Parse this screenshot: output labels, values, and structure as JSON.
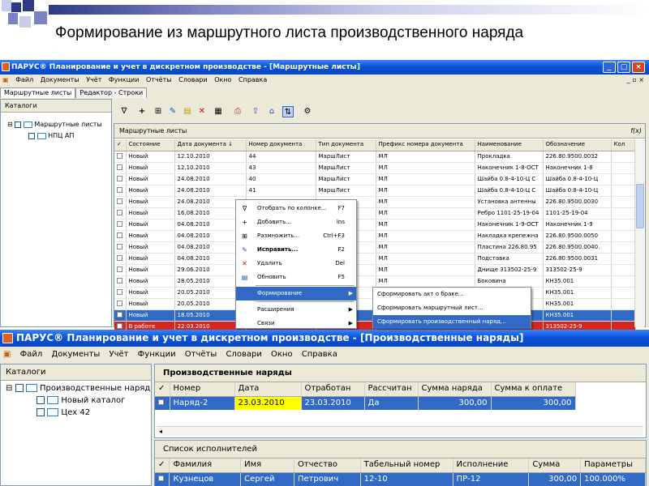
{
  "slide": {
    "title": "Формирование из маршрутного листа производственного наряда",
    "accent_colors": [
      "#2e3a85",
      "#7b82c2",
      "#c9ccea"
    ]
  },
  "window1": {
    "title": "ПАРУС® Планирование и учет в дискретном производстве - [Маршрутные листы]",
    "menu": [
      "Файл",
      "Документы",
      "Учёт",
      "Функции",
      "Отчёты",
      "Словари",
      "Окно",
      "Справка"
    ],
    "tabs": [
      "Маршрутные листы",
      "Редактор - Строки"
    ],
    "catalogs_label": "Каталоги",
    "tree": [
      "Маршрутные листы",
      "НПЦ АП"
    ],
    "grid_title": "Маршрутные листы",
    "fx_label": "f(x)",
    "columns": [
      "Состояние",
      "Дата документа ↓",
      "Номер документа",
      "Тип документа",
      "Префикс номера документа",
      "Наименование",
      "Обозначение",
      "Кол"
    ],
    "rows": [
      [
        "Новый",
        "12.10.2010",
        "44",
        "МаршЛист",
        "МЛ",
        "Прокладка",
        "226.80.9500.0032"
      ],
      [
        "Новый",
        "12.10.2010",
        "43",
        "МаршЛист",
        "МЛ",
        "Наконечник 1-8-ОСТ",
        "Наконечник 1-8"
      ],
      [
        "Новый",
        "24.08.2010",
        "40",
        "МаршЛист",
        "МЛ",
        "Шайба 0.8-4-10-Ц С",
        "Шайба 0.8-4-10-Ц"
      ],
      [
        "Новый",
        "24.08.2010",
        "41",
        "МаршЛист",
        "МЛ",
        "Шайба 0.8-4-10-Ц С",
        "Шайба 0.8-4-10-Ц"
      ],
      [
        "Новый",
        "24.08.2010",
        "42",
        "МаршЛист",
        "МЛ",
        "Установка антенны",
        "226.80.9500.0030"
      ],
      [
        "Новый",
        "16.08.2010",
        "",
        "",
        "МЛ",
        "Ребро 1101-25-19-04",
        "1101-25-19-04"
      ],
      [
        "Новый",
        "04.08.2010",
        "",
        "",
        "МЛ",
        "Наконечник 1-9-ОСТ",
        "Наконечник 1-9"
      ],
      [
        "Новый",
        "04.08.2010",
        "",
        "",
        "МЛ",
        "Накладка крепежна",
        "226.80.9500.0050"
      ],
      [
        "Новый",
        "04.08.2010",
        "",
        "",
        "МЛ",
        "Пластина 226.80.95",
        "226.80.9500.0040."
      ],
      [
        "Новый",
        "04.08.2010",
        "",
        "",
        "МЛ",
        "Подставка",
        "226.80.9500.0031"
      ],
      [
        "Новый",
        "29.06.2010",
        "",
        "",
        "МЛ",
        "Днище 313502-25-9",
        "313502-25-9"
      ],
      [
        "Новый",
        "28.05.2010",
        "",
        "",
        "МЛ",
        "Боковина",
        "КН35.001"
      ],
      [
        "Новый",
        "20.05.2010",
        "",
        "",
        "",
        "",
        "КН35.001"
      ],
      [
        "Новый",
        "20.05.2010",
        "",
        "",
        "",
        "",
        "КН35.001"
      ],
      [
        "Новый",
        "18.05.2010",
        "",
        "",
        "",
        "",
        "КН35.001"
      ],
      [
        "В работе",
        "22.03.2010",
        "",
        "",
        "",
        "",
        "313502-25-9"
      ]
    ],
    "context_menu": [
      {
        "label": "Отобрать по колонке...",
        "shortcut": "F7",
        "icon": "filter-icon"
      },
      {
        "label": "Добавить...",
        "shortcut": "Ins",
        "icon": "plus-icon"
      },
      {
        "label": "Размножить...",
        "shortcut": "Ctrl+F3",
        "icon": "copy-icon"
      },
      {
        "label": "Исправить...",
        "shortcut": "F2",
        "icon": "edit-icon"
      },
      {
        "label": "Удалить",
        "shortcut": "Del",
        "icon": "delete-icon"
      },
      {
        "label": "Обновить",
        "shortcut": "F5",
        "icon": "refresh-icon"
      },
      {
        "label": "Формирование",
        "shortcut": "",
        "icon": ""
      },
      {
        "label": "Расширения",
        "shortcut": "",
        "icon": ""
      },
      {
        "label": "Связи",
        "shortcut": "",
        "icon": ""
      }
    ],
    "submenu": [
      "Сформировать акт о браке...",
      "Сформировать маршрутный лист...",
      "Сформировать производственный наряд..."
    ]
  },
  "window2": {
    "title": "ПАРУС® Планирование и учет в дискретном производстве - [Производственные наряды]",
    "menu": [
      "Файл",
      "Документы",
      "Учёт",
      "Функции",
      "Отчёты",
      "Словари",
      "Окно",
      "Справка"
    ],
    "catalogs_label": "Каталоги",
    "tree": [
      "Производственные наряд",
      "Новый каталог",
      "Цех 42"
    ],
    "orders_title": "Производственные наряды",
    "orders_columns": [
      "Номер",
      "Дата",
      "Отработан",
      "Рассчитан",
      "Сумма наряда",
      "Сумма к оплате"
    ],
    "orders_row": [
      "Наряд-2",
      "23.03.2010",
      "23.03.2010",
      "Да",
      "300,00",
      "300,00"
    ],
    "performers_title": "Список исполнителей",
    "performers_columns": [
      "Фамилия",
      "Имя",
      "Отчество",
      "Табельный номер",
      "Исполнение",
      "Сумма",
      "Параметры"
    ],
    "performers_row": [
      "Кузнецов",
      "Сергей",
      "Петрович",
      "12-10",
      "ПР-12",
      "300,00",
      "100.000%"
    ]
  }
}
